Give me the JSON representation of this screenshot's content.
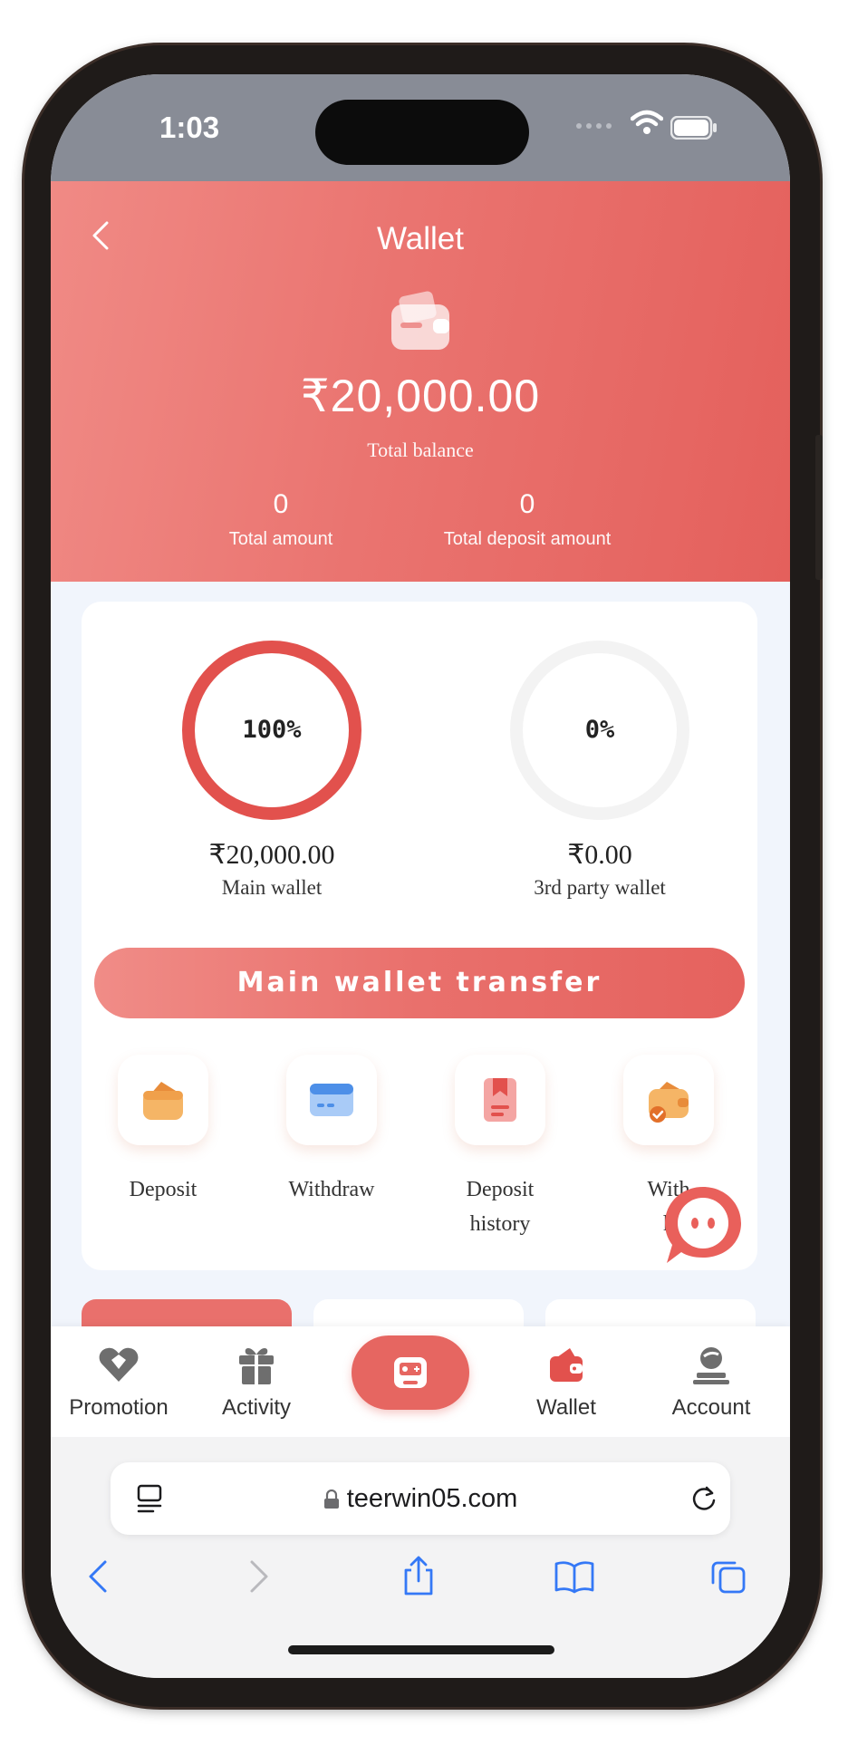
{
  "status_bar": {
    "time": "1:03"
  },
  "header": {
    "title": "Wallet",
    "total_balance": "₹20,000.00",
    "total_balance_label": "Total balance",
    "total_amount": "0",
    "total_amount_label": "Total amount",
    "total_deposit_amount": "0",
    "total_deposit_amount_label": "Total deposit amount"
  },
  "wallets": {
    "main": {
      "percent_text": "100%",
      "percent": 100,
      "amount": "₹20,000.00",
      "label": "Main wallet"
    },
    "third_party": {
      "percent_text": "0%",
      "percent": 0,
      "amount": "₹0.00",
      "label": "3rd party wallet"
    }
  },
  "transfer_button": "Main wallet transfer",
  "actions": {
    "deposit": "Deposit",
    "withdraw": "Withdraw",
    "deposit_history_line1": "Deposit",
    "deposit_history_line2": "history",
    "withdraw_history_line1": "With",
    "withdraw_history_line2": "h"
  },
  "bottom_nav": {
    "promotion": "Promotion",
    "activity": "Activity",
    "wallet": "Wallet",
    "account": "Account"
  },
  "browser": {
    "url": "teerwin05.com"
  },
  "colors": {
    "accent": "#e66661",
    "header_gradient_start": "#f08a85",
    "header_gradient_end": "#e4605c",
    "ring_track": "#f3f3f3",
    "content_bg": "#f1f5fc"
  },
  "icons": {
    "back": "chevron-left-icon",
    "card": "wallet-card-icon",
    "deposit": "wallet-deposit-icon",
    "withdraw": "credit-card-icon",
    "deposit_history": "bookmark-document-icon",
    "withdraw_history": "wallet-check-icon",
    "chat": "chat-bubble-icon",
    "promotion": "heart-diamond-icon",
    "activity": "gift-icon",
    "center": "gamepad-icon",
    "wallet": "wallet-icon",
    "account": "user-icon",
    "reader": "reader-icon",
    "lock": "lock-icon",
    "reload": "reload-icon",
    "share": "share-icon",
    "bookmarks": "book-icon",
    "tabs": "tabs-icon"
  }
}
